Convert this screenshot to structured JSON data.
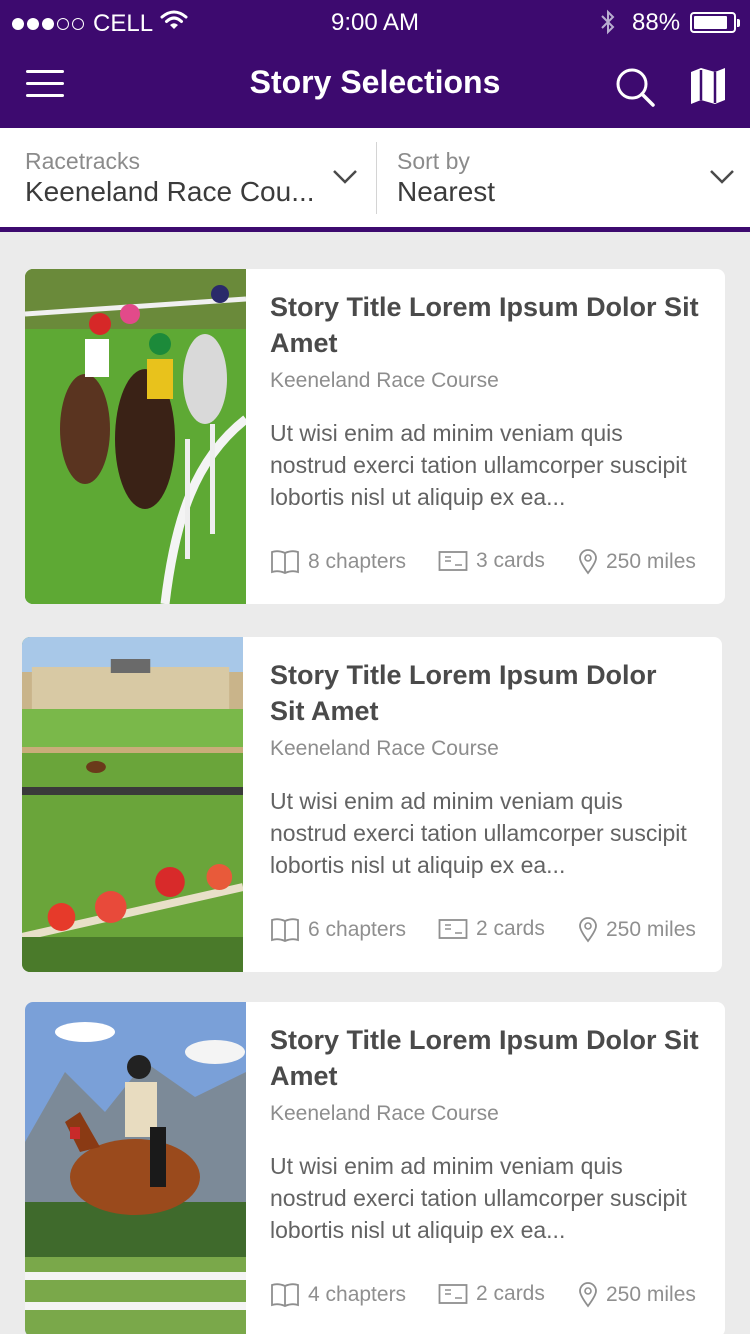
{
  "status_bar": {
    "carrier": "CELL",
    "time": "9:00 AM",
    "battery_percent": "88%",
    "battery_level": 0.88,
    "signal_bars": 3
  },
  "nav": {
    "title": "Story Selections",
    "icons": [
      "menu-icon",
      "search-icon",
      "map-icon"
    ]
  },
  "filters": {
    "racetracks": {
      "label": "Racetracks",
      "value": "Keeneland Race Cou..."
    },
    "sort": {
      "label": "Sort by",
      "value": "Nearest"
    }
  },
  "colors": {
    "brand": "#3d0a6f",
    "background": "#ebebeb",
    "card": "#ffffff"
  },
  "stories": [
    {
      "title": "Story Title Lorem Ipsum Dolor Sit Amet",
      "subtitle": "Keeneland Race Course",
      "excerpt": "Ut wisi enim ad minim veniam quis nostrud exerci tation ullamcorper suscipit lobortis nisl ut aliquip ex ea...",
      "chapters": "8 chapters",
      "cards": "3 cards",
      "distance": "250 miles",
      "image": "horse-race-photo"
    },
    {
      "title": "Story Title Lorem Ipsum Dolor Sit Amet",
      "subtitle": "Keeneland Race Course",
      "excerpt": "Ut wisi enim ad minim veniam quis nostrud exerci tation ullamcorper suscipit lobortis nisl ut aliquip ex ea...",
      "chapters": "6 chapters",
      "cards": "2 cards",
      "distance": "250 miles",
      "image": "racecourse-chateau-photo"
    },
    {
      "title": "Story Title Lorem Ipsum Dolor Sit Amet",
      "subtitle": "Keeneland Race Course",
      "excerpt": "Ut wisi enim ad minim veniam quis nostrud exerci tation ullamcorper suscipit lobortis nisl ut aliquip ex ea...",
      "chapters": "4 chapters",
      "cards": "2 cards",
      "distance": "250 miles",
      "image": "show-jumping-photo"
    }
  ]
}
